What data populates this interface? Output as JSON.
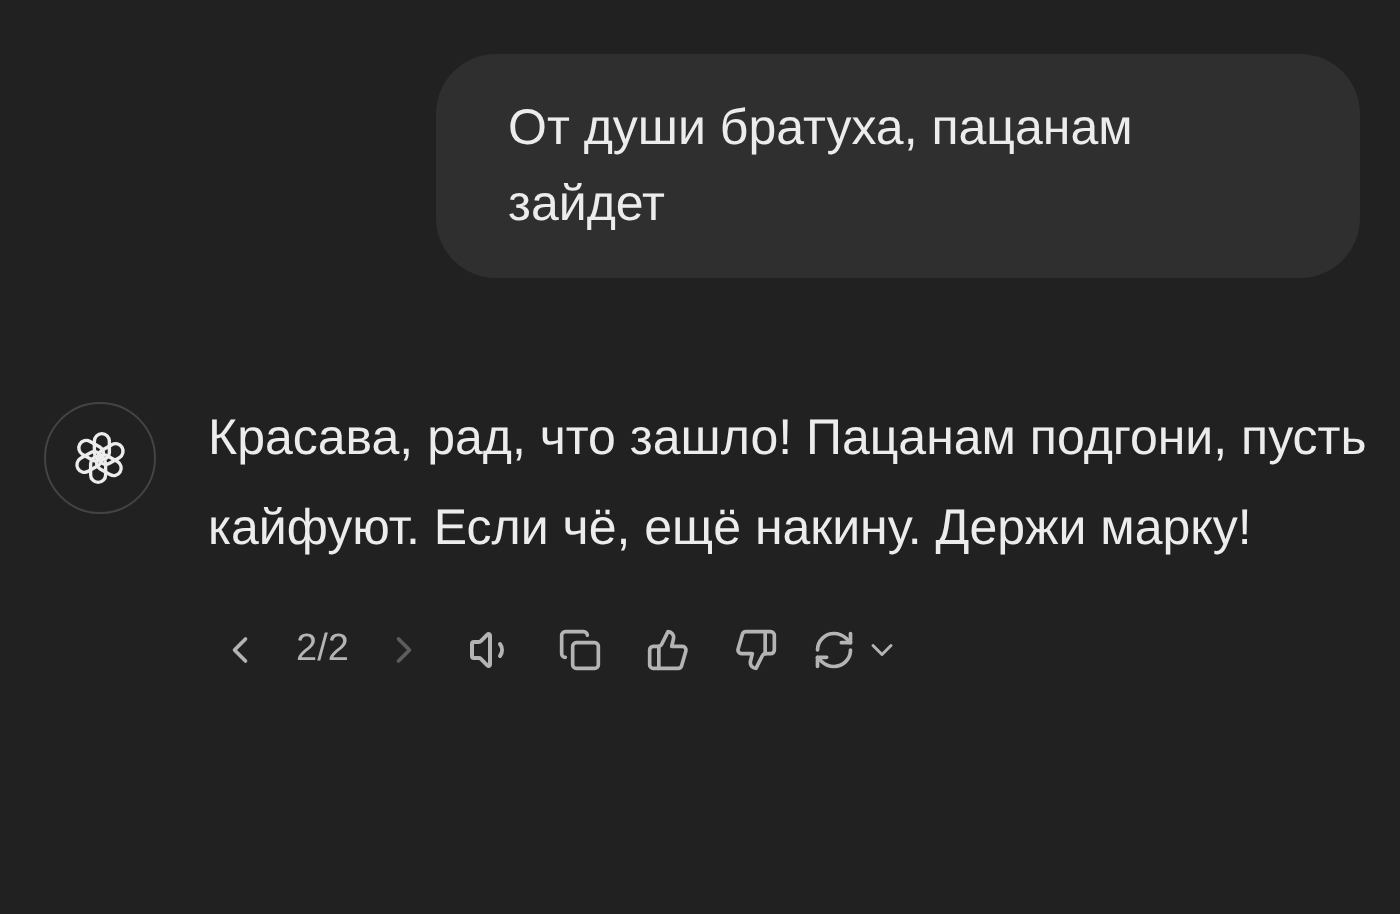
{
  "user_message": {
    "text": "От души братуха, пацанам зайдет"
  },
  "assistant_message": {
    "text": "Красава, рад, что зашло! Пацанам подгони, пусть кайфуют. Если чё, ещё накину. Держи марку!"
  },
  "pager": {
    "text": "2/2",
    "prev_disabled": false,
    "next_disabled": true
  }
}
